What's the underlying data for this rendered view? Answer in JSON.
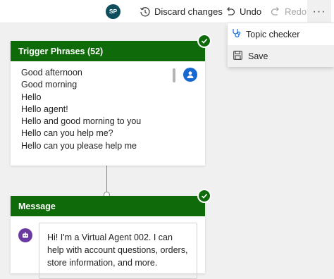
{
  "toolbar": {
    "avatar_initials": "SP",
    "discard_label": "Discard changes",
    "undo_label": "Undo",
    "redo_label": "Redo",
    "more_label": "···"
  },
  "menu": {
    "items": [
      {
        "label": "Topic checker",
        "icon": "stethoscope-icon"
      },
      {
        "label": "Save",
        "icon": "save-icon"
      }
    ]
  },
  "trigger": {
    "title": "Trigger Phrases (52)",
    "phrases": [
      "Good afternoon",
      "Good morning",
      "Hello",
      "Hello agent!",
      "Hello and good morning to you",
      "Hello can you help me?",
      "Hello can you please help me"
    ]
  },
  "message": {
    "title": "Message",
    "text": "Hi! I'm a Virtual Agent 002. I can help with account questions, orders, store information, and more."
  },
  "colors": {
    "header_green": "#0f6a0a",
    "avatar_teal": "#0e4d5c",
    "user_blue": "#1769d2",
    "bot_purple": "#6b3aa0"
  }
}
